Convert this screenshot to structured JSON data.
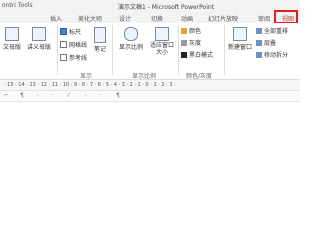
{
  "app": {
    "brand": "ordri Tools",
    "window_title": "演示文稿1 - Microsoft PowerPoint"
  },
  "tabs": [
    "插入",
    "美化大师",
    "设计",
    "切换",
    "动画",
    "幻灯片放映",
    "审阅",
    "视图"
  ],
  "active_tab": "视图",
  "ribbon": {
    "views": {
      "slide_master": "文母版",
      "handout_master": "讲义母版"
    },
    "show": {
      "ruler": "标尺",
      "gridlines": "网格线",
      "guides": "参考线",
      "notes": "笔记",
      "group_label": "显示"
    },
    "zoom": {
      "zoom": "显示比例",
      "fit": "适应窗口大小",
      "group_label": "显示比例"
    },
    "color": {
      "color": "颜色",
      "grayscale": "灰度",
      "bw": "黑白模式",
      "group_label": "颜色/灰度"
    },
    "window": {
      "new_window": "新建窗口",
      "arrange": "全部重排",
      "cascade": "层叠",
      "move_split": "移动拆分"
    }
  },
  "ruler": {
    "ticks": "· 15 · 14 · 13 · 12 · 11 · 10 · 9 · 8 · 7 · 6 · 5 · 4 · 3 · 2 · 1 · 0 · 1 · 2 · 3 ·"
  },
  "colors": {
    "accent": "#c0392b",
    "highlight": "#e02020",
    "color_swatch": "#e8a23a"
  }
}
